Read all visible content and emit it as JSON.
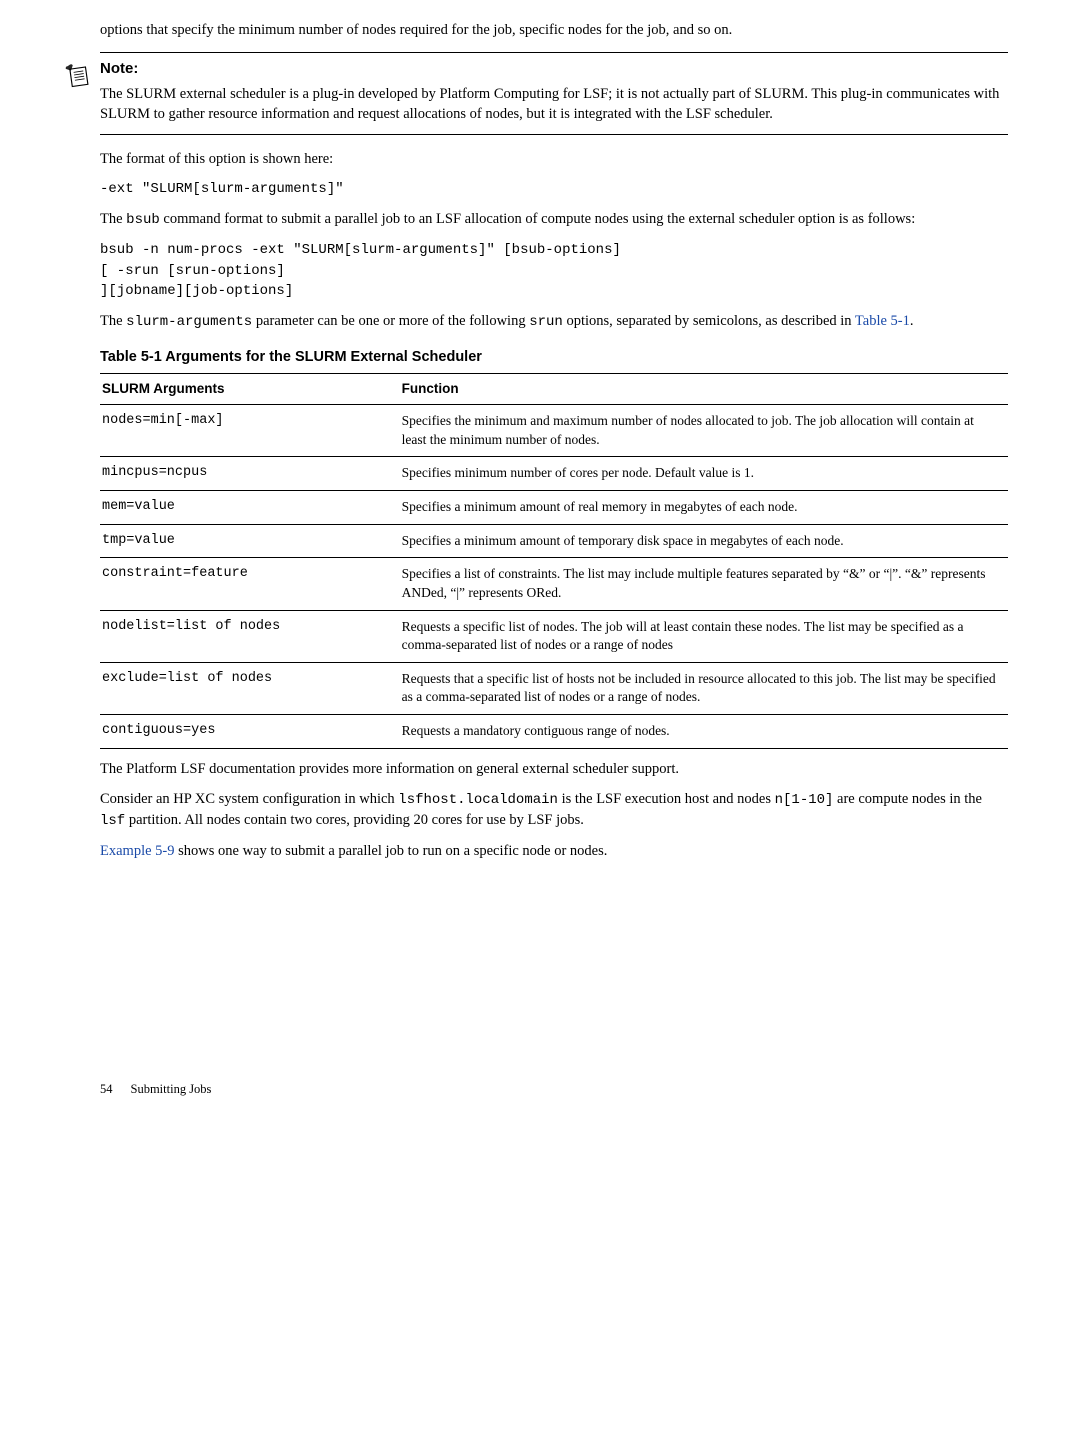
{
  "intro": "options that specify the minimum number of nodes required for the job, specific nodes for the job, and so on.",
  "note": {
    "label": "Note:",
    "text": "The SLURM external scheduler is a plug-in developed by Platform Computing for LSF; it is not actually part of SLURM. This plug-in communicates with SLURM to gather resource information and request allocations of nodes, but it is integrated with the LSF scheduler."
  },
  "format_intro": "The format of this option is shown here:",
  "format_code": "-ext \"SLURM[slurm-arguments]\"",
  "bsub_intro_pre": "The ",
  "bsub_word": "bsub",
  "bsub_intro_post": " command format to submit a parallel job to an LSF allocation of compute nodes using the external scheduler option is as follows:",
  "bsub_code": "bsub -n num-procs -ext \"SLURM[slurm-arguments]\" [bsub-options]\n[ -srun [srun-options]\n][jobname][job-options]",
  "slurm_args_para_pre": "The ",
  "slurm_args_word": "slurm-arguments",
  "slurm_args_mid": " parameter can be one or more of the following ",
  "srun_word": "srun",
  "slurm_args_mid2": " options, separated by semicolons, as described in ",
  "table_ref": "Table 5-1",
  "slurm_args_post": ".",
  "table_caption": "Table 5-1 Arguments for the SLURM External Scheduler",
  "table": {
    "head": {
      "c1": "SLURM Arguments",
      "c2": "Function"
    },
    "rows": [
      {
        "arg": "nodes=min[-max]",
        "fn": "Specifies the minimum and maximum number of nodes allocated to job. The job allocation will contain at least the minimum number of nodes."
      },
      {
        "arg": "mincpus=ncpus",
        "fn": "Specifies minimum number of cores per node. Default value is 1."
      },
      {
        "arg": "mem=value",
        "fn": "Specifies a minimum amount of real memory in megabytes of each node."
      },
      {
        "arg": "tmp=value",
        "fn": "Specifies a minimum amount of temporary disk space in megabytes of each node."
      },
      {
        "arg": "constraint=feature",
        "fn": "Specifies a list of constraints. The list may include multiple features separated by “&” or “|”. “&” represents ANDed, “|” represents ORed."
      },
      {
        "arg": "nodelist=list of nodes",
        "fn": "Requests a specific list of nodes. The job will at least contain these nodes. The list may be specified as a comma-separated list of nodes or a range of nodes"
      },
      {
        "arg": "exclude=list of nodes",
        "fn": "Requests that a specific list of hosts not be included in resource allocated to this job. The list may be specified as a comma-separated list of nodes or a range of nodes."
      },
      {
        "arg": "contiguous=yes",
        "fn": "Requests a mandatory contiguous range of nodes."
      }
    ]
  },
  "post1": "The Platform LSF documentation provides more information on general external scheduler support.",
  "post2": {
    "t1": "Consider an HP XC system configuration in which ",
    "m1": "lsfhost.localdomain",
    "t2": " is the LSF execution host and nodes ",
    "m2": "n[1-10]",
    "t3": " are compute nodes in the ",
    "m3": "lsf",
    "t4": " partition. All nodes contain two cores, providing 20 cores for use by LSF jobs."
  },
  "post3": {
    "link": "Example 5-9",
    "rest": " shows one way to submit a parallel job to run on a specific node or nodes."
  },
  "footer": {
    "pagenum": "54",
    "section": "Submitting Jobs"
  }
}
